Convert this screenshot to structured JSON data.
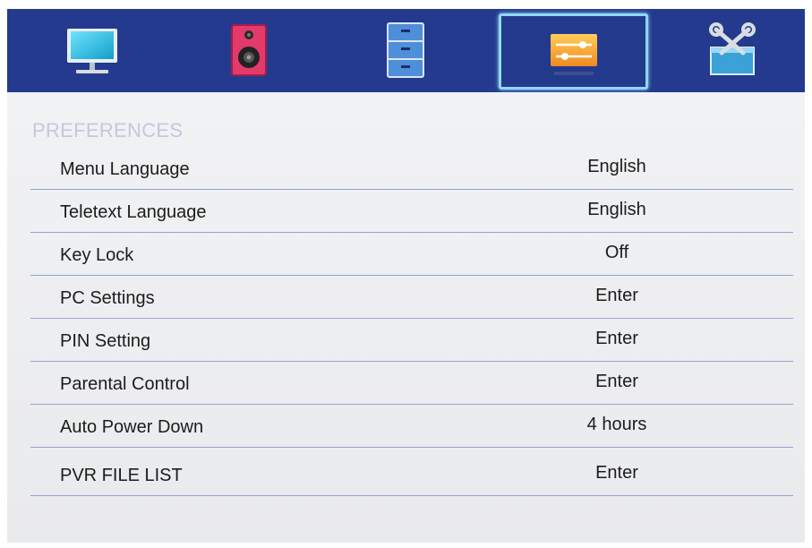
{
  "tabs": [
    {
      "icon": "tv-icon",
      "active": false
    },
    {
      "icon": "speaker-icon",
      "active": false
    },
    {
      "icon": "channel-list-icon",
      "active": false
    },
    {
      "icon": "preferences-sliders-icon",
      "active": true
    },
    {
      "icon": "tools-icon",
      "active": false
    }
  ],
  "preferences": {
    "title": "PREFERENCES",
    "items": [
      {
        "label": "Menu Language",
        "value": "English"
      },
      {
        "label": "Teletext Language",
        "value": "English"
      },
      {
        "label": "Key Lock",
        "value": "Off"
      },
      {
        "label": "PC Settings",
        "value": "Enter"
      },
      {
        "label": "PIN Setting",
        "value": "Enter"
      },
      {
        "label": "Parental Control",
        "value": "Enter"
      },
      {
        "label": "Auto Power Down",
        "value": "4 hours"
      },
      {
        "label": "PVR FILE LIST",
        "value": "Enter"
      }
    ]
  },
  "colors": {
    "tab_bar": "#243a8e",
    "selection_border": "#8fd6f4",
    "panel": "#eeeff1",
    "heading": "#c4c8dc",
    "divider": "#97a1d2"
  }
}
